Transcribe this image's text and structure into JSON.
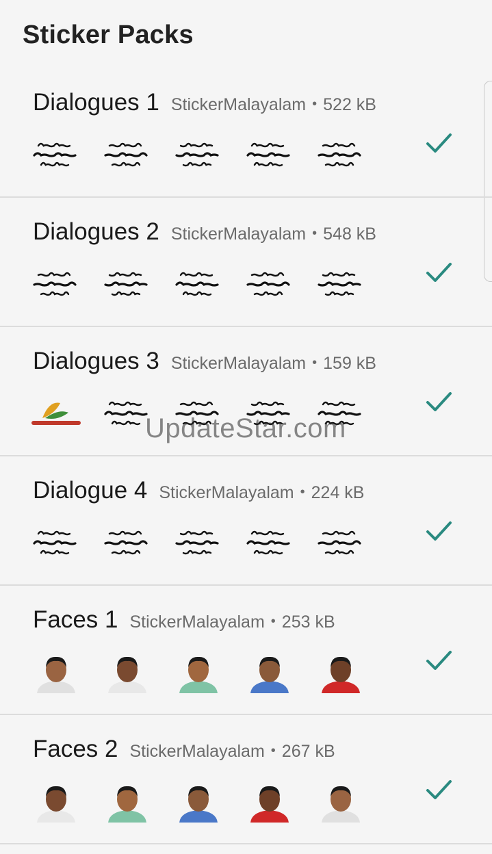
{
  "title": "Sticker Packs",
  "watermark": "UpdateStar.com",
  "accent_color": "#2a8a80",
  "packs": [
    {
      "name": "Dialogues 1",
      "publisher": "StickerMalayalam",
      "separator": "•",
      "size": "522 kB",
      "added": true,
      "stickers": [
        "text-sticker",
        "text-sticker",
        "text-sticker",
        "text-sticker",
        "text-sticker"
      ]
    },
    {
      "name": "Dialogues 2",
      "publisher": "StickerMalayalam",
      "separator": "•",
      "size": "548 kB",
      "added": true,
      "stickers": [
        "text-sticker",
        "text-sticker",
        "text-sticker",
        "text-sticker",
        "text-sticker"
      ]
    },
    {
      "name": "Dialogues 3",
      "publisher": "StickerMalayalam",
      "separator": "•",
      "size": "159 kB",
      "added": true,
      "stickers": [
        "logo-sticker",
        "text-sticker",
        "text-sticker",
        "text-sticker",
        "text-sticker"
      ]
    },
    {
      "name": "Dialogue 4",
      "publisher": "StickerMalayalam",
      "separator": "•",
      "size": "224 kB",
      "added": true,
      "stickers": [
        "text-sticker",
        "text-sticker",
        "text-sticker",
        "text-sticker",
        "text-sticker"
      ]
    },
    {
      "name": "Faces 1",
      "publisher": "StickerMalayalam",
      "separator": "•",
      "size": "253 kB",
      "added": true,
      "stickers": [
        "face-sticker",
        "face-sticker",
        "face-sticker",
        "face-sticker",
        "face-sticker"
      ]
    },
    {
      "name": "Faces 2",
      "publisher": "StickerMalayalam",
      "separator": "•",
      "size": "267 kB",
      "added": true,
      "stickers": [
        "face-sticker",
        "face-sticker",
        "face-sticker",
        "face-sticker",
        "face-sticker"
      ]
    }
  ]
}
